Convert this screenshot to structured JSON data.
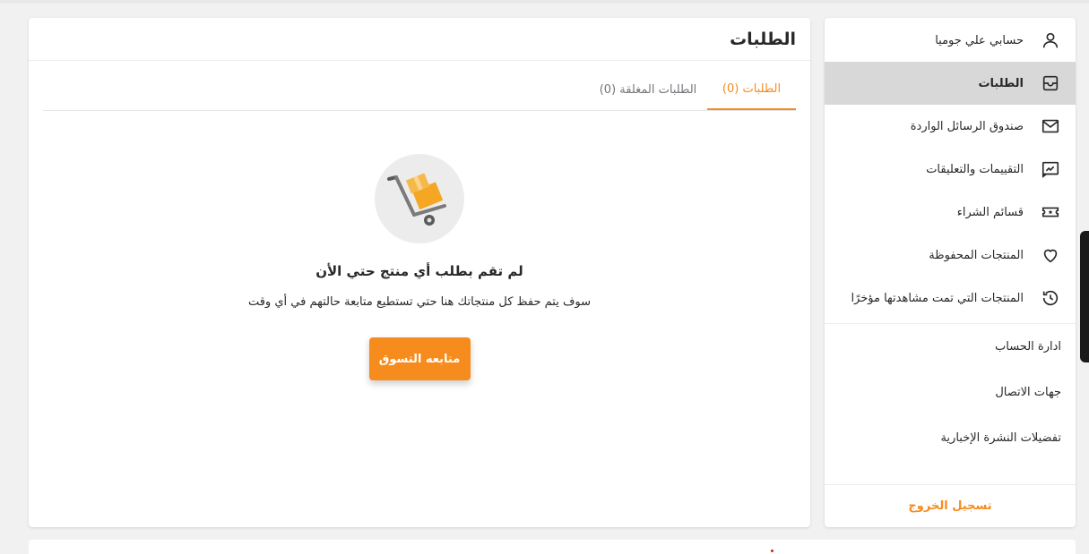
{
  "sidebar": {
    "items": [
      {
        "label": "حسابي علي جوميا",
        "icon": "user-icon",
        "active": false
      },
      {
        "label": "الطلبات",
        "icon": "orders-box-icon",
        "active": true
      },
      {
        "label": "صندوق الرسائل الواردة",
        "icon": "envelope-icon",
        "active": false
      },
      {
        "label": "التقييمات والتعليقات",
        "icon": "review-icon",
        "active": false
      },
      {
        "label": "قسائم الشراء",
        "icon": "voucher-icon",
        "active": false
      },
      {
        "label": "المنتجات المحفوظة",
        "icon": "heart-icon",
        "active": false
      },
      {
        "label": "المنتجات التي تمت مشاهدتها مؤخرًا",
        "icon": "history-icon",
        "active": false
      }
    ],
    "links": [
      {
        "label": "ادارة الحساب"
      },
      {
        "label": "جهات الاتصال"
      },
      {
        "label": "تفضيلات النشرة الإخبارية"
      }
    ],
    "logout_label": "تسجيل الخروج"
  },
  "main": {
    "title": "الطلبات",
    "tabs": [
      {
        "label": "الطلبات (0)",
        "active": true
      },
      {
        "label": "الطلبات المغلقة (0)",
        "active": false
      }
    ],
    "empty_state": {
      "icon": "hand-truck-box-icon",
      "title": "لم تقم بطلب أي منتج حتي الأن",
      "description": "سوف يتم حفظ كل منتجاتك هنا حتي تستطيع متابعة حالتهم في أي وقت",
      "button_label": "متابعه التسوق"
    }
  },
  "colors": {
    "accent": "#f68b1e",
    "page_bg": "#f1f1f2",
    "active_item_bg": "#d8d8d8"
  }
}
